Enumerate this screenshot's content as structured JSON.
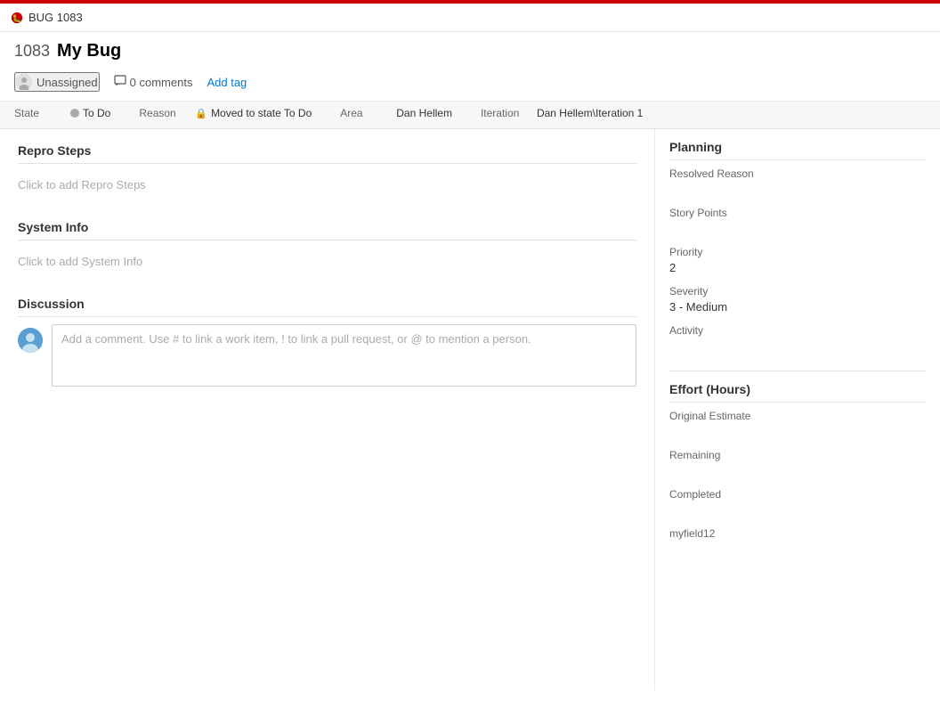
{
  "titleBar": {
    "bugLabel": "BUG 1083",
    "icon": "bug-icon"
  },
  "workItem": {
    "id": "1083",
    "name": "My Bug",
    "assignedTo": "Unassigned",
    "commentsCount": "0 comments",
    "addTagLabel": "Add tag"
  },
  "fields": {
    "stateLabel": "State",
    "stateValue": "To Do",
    "reasonLabel": "Reason",
    "reasonValue": "Moved to state To Do",
    "areaLabel": "Area",
    "areaValue": "Dan Hellem",
    "iterationLabel": "Iteration",
    "iterationValue": "Dan Hellem\\Iteration 1"
  },
  "leftPanel": {
    "reproStepsTitle": "Repro Steps",
    "reproStepsPlaceholder": "Click to add Repro Steps",
    "systemInfoTitle": "System Info",
    "systemInfoPlaceholder": "Click to add System Info",
    "discussionTitle": "Discussion",
    "commentPlaceholder": "Add a comment. Use # to link a work item, ! to link a pull request, or @ to mention a person."
  },
  "rightPanel": {
    "planningTitle": "Planning",
    "resolvedReasonLabel": "Resolved Reason",
    "resolvedReasonValue": "",
    "storyPointsLabel": "Story Points",
    "storyPointsValue": "",
    "priorityLabel": "Priority",
    "priorityValue": "2",
    "severityLabel": "Severity",
    "severityValue": "3 - Medium",
    "activityLabel": "Activity",
    "activityValue": "",
    "effortTitle": "Effort (Hours)",
    "originalEstimateLabel": "Original Estimate",
    "originalEstimateValue": "",
    "remainingLabel": "Remaining",
    "remainingValue": "",
    "completedLabel": "Completed",
    "completedValue": "",
    "myfield12Label": "myfield12",
    "myfield12Value": ""
  }
}
